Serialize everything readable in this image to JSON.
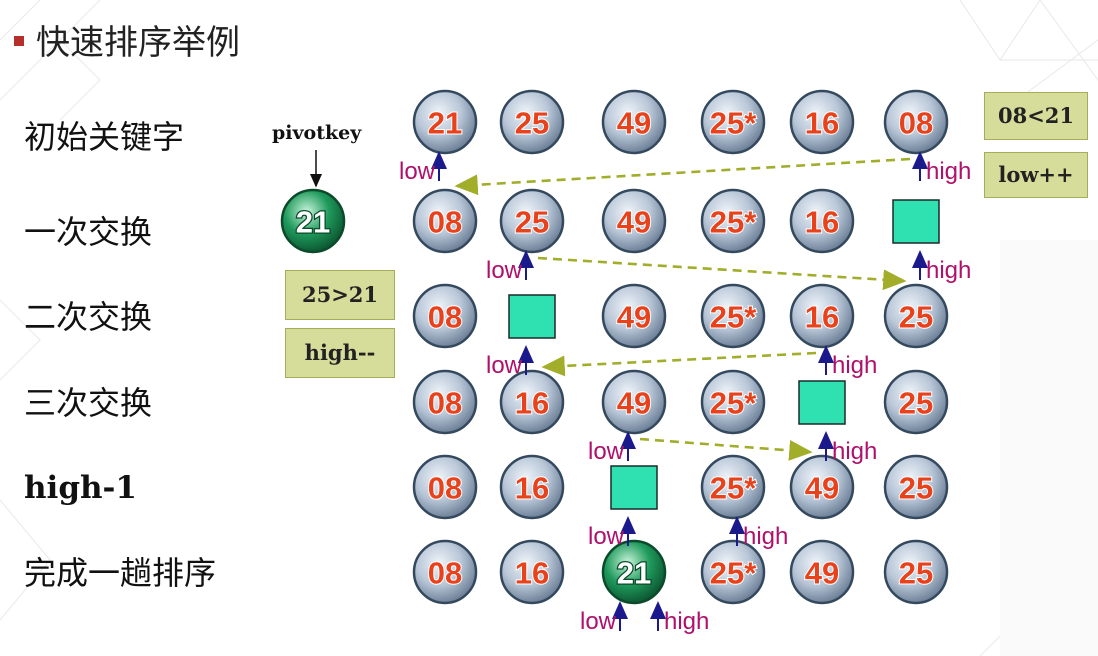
{
  "title": "快速排序举例",
  "pivot_label": "pivotkey",
  "pivot_value": "21",
  "row_labels": [
    "初始关键字",
    "一次交换",
    "二次交换",
    "三次交换",
    "high-1",
    "完成一趟排序"
  ],
  "notes": {
    "n1": "08<21",
    "n2": "low++",
    "n3": "25>21",
    "n4": "high--"
  },
  "marker_labels": {
    "low": "low",
    "high": "high"
  },
  "rows": [
    [
      {
        "t": "circle",
        "v": "21"
      },
      {
        "t": "circle",
        "v": "25"
      },
      {
        "t": "circle",
        "v": "49"
      },
      {
        "t": "circle",
        "v": "25*"
      },
      {
        "t": "circle",
        "v": "16"
      },
      {
        "t": "circle",
        "v": "08"
      }
    ],
    [
      {
        "t": "circle",
        "v": "08"
      },
      {
        "t": "circle",
        "v": "25"
      },
      {
        "t": "circle",
        "v": "49"
      },
      {
        "t": "circle",
        "v": "25*"
      },
      {
        "t": "circle",
        "v": "16"
      },
      {
        "t": "empty"
      }
    ],
    [
      {
        "t": "circle",
        "v": "08"
      },
      {
        "t": "empty"
      },
      {
        "t": "circle",
        "v": "49"
      },
      {
        "t": "circle",
        "v": "25*"
      },
      {
        "t": "circle",
        "v": "16"
      },
      {
        "t": "circle",
        "v": "25"
      }
    ],
    [
      {
        "t": "circle",
        "v": "08"
      },
      {
        "t": "circle",
        "v": "16"
      },
      {
        "t": "circle",
        "v": "49"
      },
      {
        "t": "circle",
        "v": "25*"
      },
      {
        "t": "empty"
      },
      {
        "t": "circle",
        "v": "25"
      }
    ],
    [
      {
        "t": "circle",
        "v": "08"
      },
      {
        "t": "circle",
        "v": "16"
      },
      {
        "t": "empty"
      },
      {
        "t": "circle",
        "v": "25*"
      },
      {
        "t": "circle",
        "v": "49"
      },
      {
        "t": "circle",
        "v": "25"
      }
    ],
    [
      {
        "t": "circle",
        "v": "08"
      },
      {
        "t": "circle",
        "v": "16"
      },
      {
        "t": "circle",
        "v": "21",
        "green": true
      },
      {
        "t": "circle",
        "v": "25*"
      },
      {
        "t": "circle",
        "v": "49"
      },
      {
        "t": "circle",
        "v": "25"
      }
    ]
  ],
  "pointers": [
    {
      "row": 0,
      "low": 0,
      "high": 5
    },
    {
      "row": 1,
      "low": 1,
      "high": 5
    },
    {
      "row": 2,
      "low": 1,
      "high": 4
    },
    {
      "row": 3,
      "low": 2,
      "high": 4
    },
    {
      "row": 4,
      "low": 2,
      "high": 3
    },
    {
      "row": 5,
      "low": 2,
      "high": 2
    }
  ],
  "moves": [
    {
      "from_row": 0,
      "from_col": 5,
      "to_row": 1,
      "to_col": 0
    },
    {
      "from_row": 1,
      "from_col": 1,
      "to_row": 2,
      "to_col": 5
    },
    {
      "from_row": 2,
      "from_col": 4,
      "to_row": 3,
      "to_col": 1
    },
    {
      "from_row": 3,
      "from_col": 2,
      "to_row": 4,
      "to_col": 4
    }
  ],
  "colors": {
    "circle_fill": "#b9c7d8",
    "circle_edge": "#34495e",
    "number_red": "#e8421c",
    "pivot_green": "#1f9a5c",
    "empty_slot": "#2fe0b0",
    "marker_text": "#b0106a",
    "marker_arrow": "#1a1a8c",
    "move_arrow": "#a2ad2a",
    "note_fill": "#d6dc9a",
    "title_bullet": "#b5302a"
  }
}
